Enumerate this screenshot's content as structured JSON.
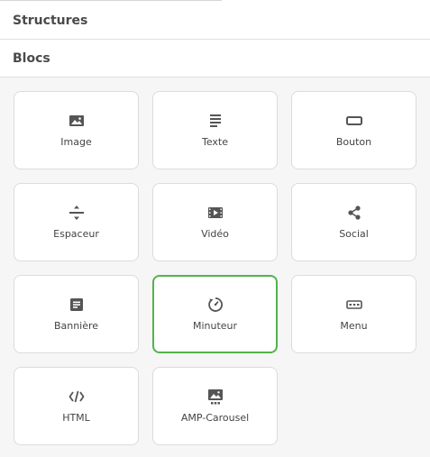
{
  "sections": {
    "structures": {
      "label": "Structures"
    },
    "blocs": {
      "label": "Blocs"
    }
  },
  "colors": {
    "icon": "#555555",
    "selected_border": "#52b34b",
    "tile_border": "#dcdcdc",
    "panel_background": "#f6f6f6"
  },
  "blocks": [
    {
      "label": "Image",
      "icon": "image-icon"
    },
    {
      "label": "Texte",
      "icon": "text-lines-icon"
    },
    {
      "label": "Bouton",
      "icon": "button-icon"
    },
    {
      "label": "Espaceur",
      "icon": "spacer-icon"
    },
    {
      "label": "Vidéo",
      "icon": "video-icon"
    },
    {
      "label": "Social",
      "icon": "share-icon"
    },
    {
      "label": "Bannière",
      "icon": "banner-icon"
    },
    {
      "label": "Minuteur",
      "icon": "timer-icon",
      "selected": true
    },
    {
      "label": "Menu",
      "icon": "menu-icon"
    },
    {
      "label": "HTML",
      "icon": "code-icon"
    },
    {
      "label": "AMP-Carousel",
      "icon": "carousel-icon"
    }
  ]
}
